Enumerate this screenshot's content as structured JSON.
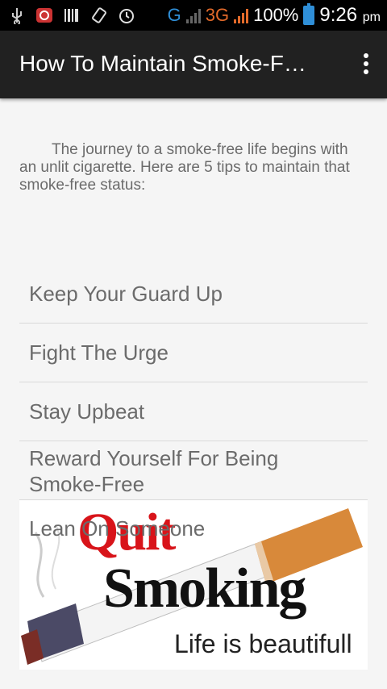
{
  "status_bar": {
    "icons": [
      "usb-icon",
      "notification-app-icon",
      "barcode-icon",
      "screen-rotation-icon",
      "alarm-icon"
    ],
    "net1": "G",
    "net2": "3G",
    "battery": "100%",
    "time": "9:26",
    "ampm": "pm"
  },
  "appbar": {
    "title": "How To Maintain Smoke-F…",
    "overflow_icon": "overflow-menu-icon"
  },
  "intro_text": "The journey to a smoke-free life begins with an unlit cigarette. Here are 5 tips to maintain that smoke-free status:",
  "tips": [
    {
      "label": "Keep Your Guard Up"
    },
    {
      "label": "Fight The Urge"
    },
    {
      "label": "Stay Upbeat"
    },
    {
      "label": "Reward Yourself For Being Smoke-Free"
    },
    {
      "label": "Lean On Someone"
    }
  ],
  "banner": {
    "word1": "Quit",
    "word2": "Smoking",
    "tagline": "Life is beautifull"
  },
  "colors": {
    "appbar": "#212121",
    "quit_red": "#d8141a",
    "accent_blue": "#2f8fd8",
    "accent_orange": "#e36a2a"
  }
}
